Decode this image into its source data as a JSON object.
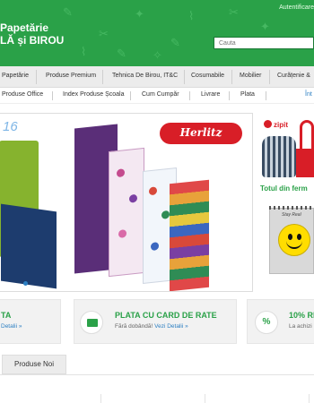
{
  "header": {
    "auth_text": "Autentificare",
    "logo_line1": "Papetărie",
    "logo_line2": "LĂ și BIROU",
    "search_placeholder": "Cauta"
  },
  "main_nav": [
    {
      "label": "Papetărie"
    },
    {
      "label": "Produse Premium"
    },
    {
      "label": "Tehnica De Birou, IT&C"
    },
    {
      "label": "Cosumabile"
    },
    {
      "label": "Mobilier"
    },
    {
      "label": "Curățenie &"
    }
  ],
  "sub_nav": [
    {
      "label": "Produse Office"
    },
    {
      "label": "Index Produse Școala"
    },
    {
      "label": "Cum Cumpăr"
    },
    {
      "label": "Livrare"
    },
    {
      "label": "Plata"
    },
    {
      "label": "Înt"
    }
  ],
  "banner": {
    "year_text": "16",
    "brand": "Herlitz"
  },
  "side_promo": {
    "brand": "zipit",
    "caption": "Totul din ferm",
    "notebook_text": "Stay Real"
  },
  "info_cards": [
    {
      "title": "TA",
      "sub_link": "Detalii »"
    },
    {
      "title": "PLATA CU CARD DE RATE",
      "sub_text": "Fără dobândă!",
      "sub_link": "Vezi Detalii »"
    },
    {
      "title": "10% RE",
      "sub_text": "La achizi"
    }
  ],
  "tabs": {
    "new_products_label": "Produse Noi"
  },
  "colors": {
    "brand_green": "#2aa148",
    "link_blue": "#2c7fc2",
    "herlitz_red": "#d81e27"
  }
}
